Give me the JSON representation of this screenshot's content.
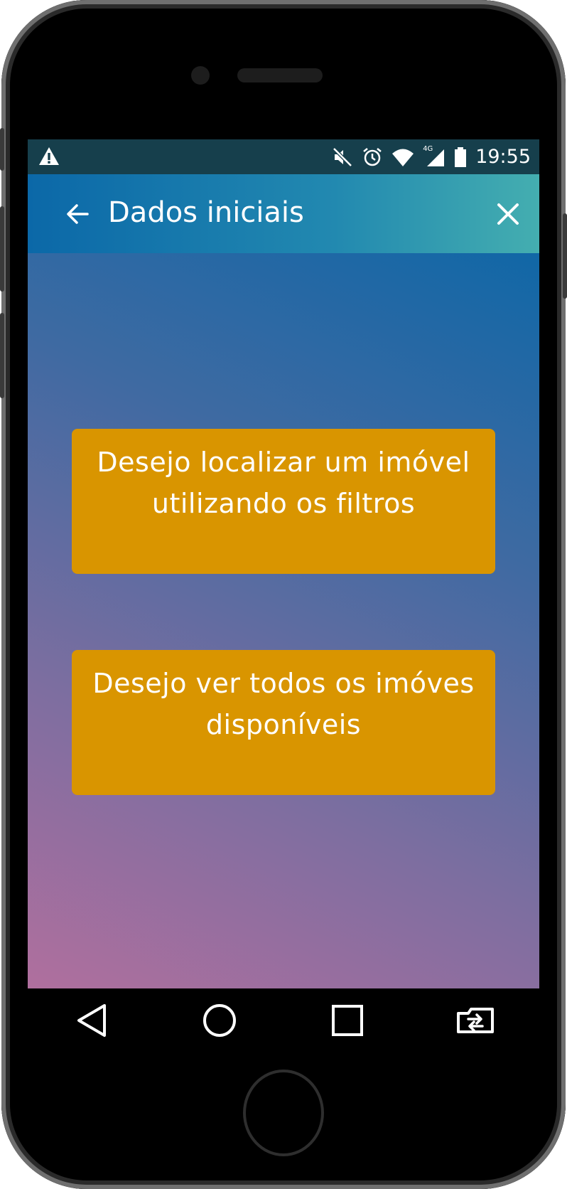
{
  "status_bar": {
    "time": "19:55",
    "network": "4G",
    "icons": [
      "warning-icon",
      "mute-icon",
      "alarm-icon",
      "wifi-icon",
      "signal-icon",
      "battery-icon"
    ]
  },
  "app_bar": {
    "title": "Dados iniciais",
    "back_icon": "arrow-left-icon",
    "close_icon": "close-icon"
  },
  "options": [
    {
      "label": "Desejo localizar um imóvel utilizando os filtros"
    },
    {
      "label": "Desejo ver todos os imóves disponíveis"
    }
  ],
  "nav_bar": {
    "icons": [
      "back-triangle-icon",
      "home-circle-icon",
      "recents-square-icon",
      "switch-app-icon"
    ]
  },
  "colors": {
    "status_bar": "#163f4c",
    "app_bar_start": "#0b68a8",
    "app_bar_end": "#44aeb0",
    "option_button": "#d99500",
    "background_top": "#0066a8",
    "background_bottom": "#b06f9e"
  }
}
